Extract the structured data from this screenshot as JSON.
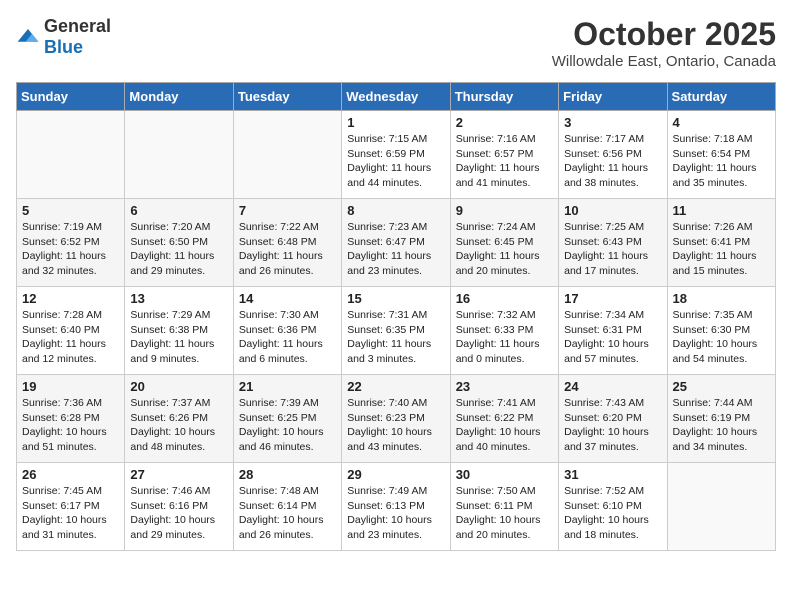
{
  "logo": {
    "general": "General",
    "blue": "Blue"
  },
  "header": {
    "month": "October 2025",
    "location": "Willowdale East, Ontario, Canada"
  },
  "weekdays": [
    "Sunday",
    "Monday",
    "Tuesday",
    "Wednesday",
    "Thursday",
    "Friday",
    "Saturday"
  ],
  "weeks": [
    [
      {
        "day": "",
        "sunrise": "",
        "sunset": "",
        "daylight": ""
      },
      {
        "day": "",
        "sunrise": "",
        "sunset": "",
        "daylight": ""
      },
      {
        "day": "",
        "sunrise": "",
        "sunset": "",
        "daylight": ""
      },
      {
        "day": "1",
        "sunrise": "Sunrise: 7:15 AM",
        "sunset": "Sunset: 6:59 PM",
        "daylight": "Daylight: 11 hours and 44 minutes."
      },
      {
        "day": "2",
        "sunrise": "Sunrise: 7:16 AM",
        "sunset": "Sunset: 6:57 PM",
        "daylight": "Daylight: 11 hours and 41 minutes."
      },
      {
        "day": "3",
        "sunrise": "Sunrise: 7:17 AM",
        "sunset": "Sunset: 6:56 PM",
        "daylight": "Daylight: 11 hours and 38 minutes."
      },
      {
        "day": "4",
        "sunrise": "Sunrise: 7:18 AM",
        "sunset": "Sunset: 6:54 PM",
        "daylight": "Daylight: 11 hours and 35 minutes."
      }
    ],
    [
      {
        "day": "5",
        "sunrise": "Sunrise: 7:19 AM",
        "sunset": "Sunset: 6:52 PM",
        "daylight": "Daylight: 11 hours and 32 minutes."
      },
      {
        "day": "6",
        "sunrise": "Sunrise: 7:20 AM",
        "sunset": "Sunset: 6:50 PM",
        "daylight": "Daylight: 11 hours and 29 minutes."
      },
      {
        "day": "7",
        "sunrise": "Sunrise: 7:22 AM",
        "sunset": "Sunset: 6:48 PM",
        "daylight": "Daylight: 11 hours and 26 minutes."
      },
      {
        "day": "8",
        "sunrise": "Sunrise: 7:23 AM",
        "sunset": "Sunset: 6:47 PM",
        "daylight": "Daylight: 11 hours and 23 minutes."
      },
      {
        "day": "9",
        "sunrise": "Sunrise: 7:24 AM",
        "sunset": "Sunset: 6:45 PM",
        "daylight": "Daylight: 11 hours and 20 minutes."
      },
      {
        "day": "10",
        "sunrise": "Sunrise: 7:25 AM",
        "sunset": "Sunset: 6:43 PM",
        "daylight": "Daylight: 11 hours and 17 minutes."
      },
      {
        "day": "11",
        "sunrise": "Sunrise: 7:26 AM",
        "sunset": "Sunset: 6:41 PM",
        "daylight": "Daylight: 11 hours and 15 minutes."
      }
    ],
    [
      {
        "day": "12",
        "sunrise": "Sunrise: 7:28 AM",
        "sunset": "Sunset: 6:40 PM",
        "daylight": "Daylight: 11 hours and 12 minutes."
      },
      {
        "day": "13",
        "sunrise": "Sunrise: 7:29 AM",
        "sunset": "Sunset: 6:38 PM",
        "daylight": "Daylight: 11 hours and 9 minutes."
      },
      {
        "day": "14",
        "sunrise": "Sunrise: 7:30 AM",
        "sunset": "Sunset: 6:36 PM",
        "daylight": "Daylight: 11 hours and 6 minutes."
      },
      {
        "day": "15",
        "sunrise": "Sunrise: 7:31 AM",
        "sunset": "Sunset: 6:35 PM",
        "daylight": "Daylight: 11 hours and 3 minutes."
      },
      {
        "day": "16",
        "sunrise": "Sunrise: 7:32 AM",
        "sunset": "Sunset: 6:33 PM",
        "daylight": "Daylight: 11 hours and 0 minutes."
      },
      {
        "day": "17",
        "sunrise": "Sunrise: 7:34 AM",
        "sunset": "Sunset: 6:31 PM",
        "daylight": "Daylight: 10 hours and 57 minutes."
      },
      {
        "day": "18",
        "sunrise": "Sunrise: 7:35 AM",
        "sunset": "Sunset: 6:30 PM",
        "daylight": "Daylight: 10 hours and 54 minutes."
      }
    ],
    [
      {
        "day": "19",
        "sunrise": "Sunrise: 7:36 AM",
        "sunset": "Sunset: 6:28 PM",
        "daylight": "Daylight: 10 hours and 51 minutes."
      },
      {
        "day": "20",
        "sunrise": "Sunrise: 7:37 AM",
        "sunset": "Sunset: 6:26 PM",
        "daylight": "Daylight: 10 hours and 48 minutes."
      },
      {
        "day": "21",
        "sunrise": "Sunrise: 7:39 AM",
        "sunset": "Sunset: 6:25 PM",
        "daylight": "Daylight: 10 hours and 46 minutes."
      },
      {
        "day": "22",
        "sunrise": "Sunrise: 7:40 AM",
        "sunset": "Sunset: 6:23 PM",
        "daylight": "Daylight: 10 hours and 43 minutes."
      },
      {
        "day": "23",
        "sunrise": "Sunrise: 7:41 AM",
        "sunset": "Sunset: 6:22 PM",
        "daylight": "Daylight: 10 hours and 40 minutes."
      },
      {
        "day": "24",
        "sunrise": "Sunrise: 7:43 AM",
        "sunset": "Sunset: 6:20 PM",
        "daylight": "Daylight: 10 hours and 37 minutes."
      },
      {
        "day": "25",
        "sunrise": "Sunrise: 7:44 AM",
        "sunset": "Sunset: 6:19 PM",
        "daylight": "Daylight: 10 hours and 34 minutes."
      }
    ],
    [
      {
        "day": "26",
        "sunrise": "Sunrise: 7:45 AM",
        "sunset": "Sunset: 6:17 PM",
        "daylight": "Daylight: 10 hours and 31 minutes."
      },
      {
        "day": "27",
        "sunrise": "Sunrise: 7:46 AM",
        "sunset": "Sunset: 6:16 PM",
        "daylight": "Daylight: 10 hours and 29 minutes."
      },
      {
        "day": "28",
        "sunrise": "Sunrise: 7:48 AM",
        "sunset": "Sunset: 6:14 PM",
        "daylight": "Daylight: 10 hours and 26 minutes."
      },
      {
        "day": "29",
        "sunrise": "Sunrise: 7:49 AM",
        "sunset": "Sunset: 6:13 PM",
        "daylight": "Daylight: 10 hours and 23 minutes."
      },
      {
        "day": "30",
        "sunrise": "Sunrise: 7:50 AM",
        "sunset": "Sunset: 6:11 PM",
        "daylight": "Daylight: 10 hours and 20 minutes."
      },
      {
        "day": "31",
        "sunrise": "Sunrise: 7:52 AM",
        "sunset": "Sunset: 6:10 PM",
        "daylight": "Daylight: 10 hours and 18 minutes."
      },
      {
        "day": "",
        "sunrise": "",
        "sunset": "",
        "daylight": ""
      }
    ]
  ]
}
